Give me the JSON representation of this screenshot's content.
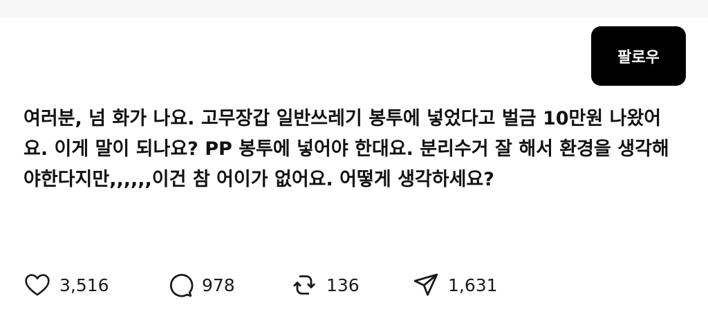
{
  "header": {
    "follow_label": "팔로우"
  },
  "post": {
    "text": "여러분, 넘 화가 나요. 고무장갑 일반쓰레기 봉투에 넣었다고 벌금 10만원 나왔어요. 이게 말이 되나요? PP 봉투에 넣어야 한대요. 분리수거 잘 해서 환경을 생각해야한다지만,,,,,,이건 참 어이가 없어요. 어떻게 생각하세요?"
  },
  "actions": {
    "likes": "3,516",
    "comments": "978",
    "reposts": "136",
    "shares": "1,631"
  },
  "icons": {
    "like": "heart-icon",
    "comment": "speech-bubble-icon",
    "repost": "repost-arrows-icon",
    "share": "paper-plane-icon"
  }
}
